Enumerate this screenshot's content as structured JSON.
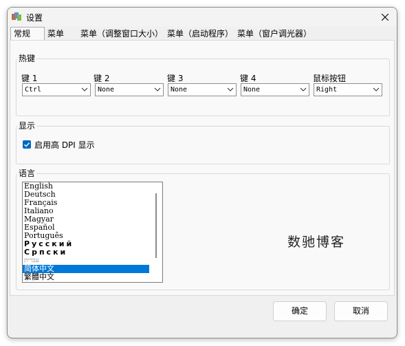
{
  "window": {
    "title": "设置"
  },
  "tabs": [
    {
      "label": "常规"
    },
    {
      "label": "菜单"
    },
    {
      "label": "菜单（调整窗口大小）"
    },
    {
      "label": "菜单（启动程序）"
    },
    {
      "label": "菜单（窗户调光器）"
    }
  ],
  "hotkeys": {
    "legend": "热键",
    "fields": [
      {
        "label": "键 1",
        "value": "Ctrl"
      },
      {
        "label": "键 2",
        "value": "None"
      },
      {
        "label": "键 3",
        "value": "None"
      },
      {
        "label": "键 4",
        "value": "None"
      },
      {
        "label": "鼠标按钮",
        "value": "Right"
      }
    ]
  },
  "display": {
    "legend": "显示",
    "checkbox_label": "启用高 DPI 显示",
    "checked": true
  },
  "language": {
    "legend": "语言",
    "items": [
      "English",
      "Deutsch",
      "Français",
      "Italiano",
      "Magyar",
      "Español",
      "Português",
      "Русский",
      "Српски",
      "עברית",
      "简体中文",
      "繁體中文"
    ],
    "selected": "简体中文"
  },
  "watermark": "数驰博客",
  "buttons": {
    "ok": "确定",
    "cancel": "取消"
  },
  "colors": {
    "accent": "#0067c0",
    "selection": "#0078d7"
  }
}
